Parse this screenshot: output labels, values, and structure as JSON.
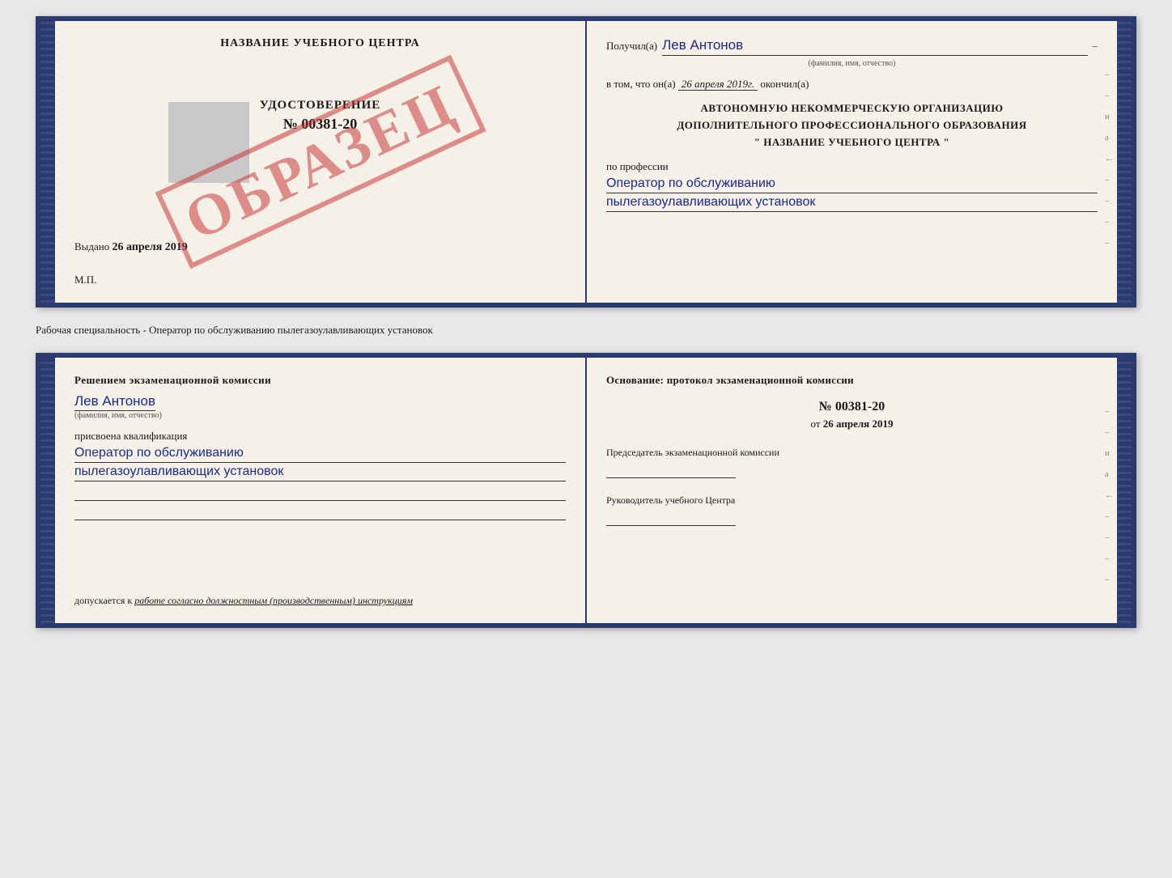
{
  "page": {
    "background": "#e8e8e8"
  },
  "top_cert": {
    "left": {
      "title": "НАЗВАНИЕ УЧЕБНОГО ЦЕНТРА",
      "obrazets": "ОБРАЗЕЦ",
      "udostoverenie_label": "УДОСТОВЕРЕНИЕ",
      "udostoverenie_number": "№ 00381-20",
      "vydano_label": "Выдано",
      "vydano_date": "26 апреля 2019",
      "mp_label": "М.П."
    },
    "right": {
      "poluchil_label": "Получил(а)",
      "name_handwritten": "Лев Антонов",
      "fio_hint": "(фамилия, имя, отчество)",
      "dash": "–",
      "vtom_label": "в том, что он(а)",
      "date_handwritten": "26 апреля 2019г.",
      "okonchil_label": "окончил(а)",
      "org_line1": "АВТОНОМНУЮ НЕКОММЕРЧЕСКУЮ ОРГАНИЗАЦИЮ",
      "org_line2": "ДОПОЛНИТЕЛЬНОГО ПРОФЕССИОНАЛЬНОГО ОБРАЗОВАНИЯ",
      "org_line3": "\"   НАЗВАНИЕ УЧЕБНОГО ЦЕНТРА   \"",
      "po_professii": "по профессии",
      "profession_line1": "Оператор по обслуживанию",
      "profession_line2": "пылегазоулавливающих установок"
    }
  },
  "separator": {
    "text": "Рабочая специальность - Оператор по обслуживанию пылегазоулавливающих установок"
  },
  "bottom_cert": {
    "left": {
      "resheniem_label": "Решением экзаменационной комиссии",
      "name_handwritten": "Лев Антонов",
      "fio_hint": "(фамилия, имя, отчество)",
      "prisvoena_label": "присвоена квалификация",
      "qualification_line1": "Оператор по обслуживанию",
      "qualification_line2": "пылегазоулавливающих установок",
      "dopuskaetsya_label": "допускается к",
      "dopuskaetsya_text": "работе согласно должностным (производственным) инструкциям"
    },
    "right": {
      "osnovanie_label": "Основание: протокол экзаменационной комиссии",
      "protocol_number": "№ 00381-20",
      "ot_label": "от",
      "ot_date": "26 апреля 2019",
      "predsedatel_label": "Председатель экзаменационной комиссии",
      "rukovoditel_label": "Руководитель учебного Центра"
    }
  },
  "side_chars": {
    "и": "и",
    "а": "а",
    "lt": "←",
    "dashes": [
      "–",
      "–",
      "–",
      "–"
    ]
  }
}
